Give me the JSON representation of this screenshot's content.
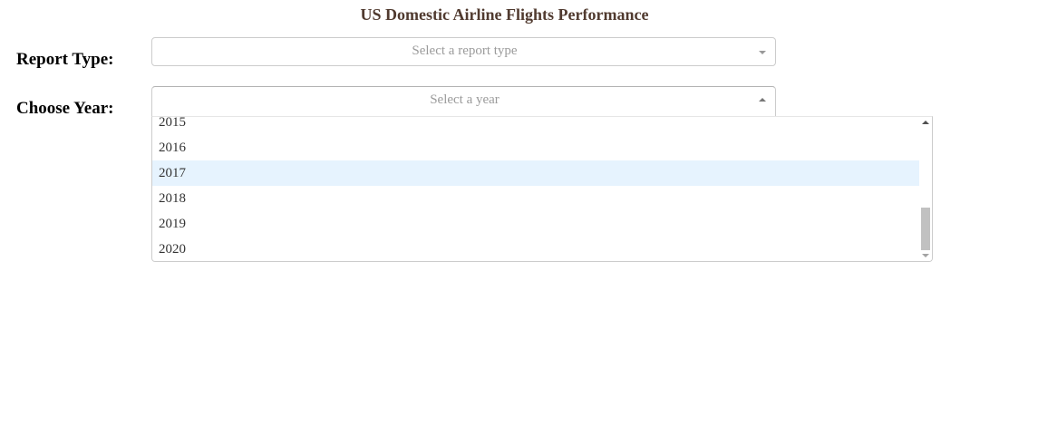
{
  "header": {
    "title": "US Domestic Airline Flights Performance"
  },
  "report_type": {
    "label": "Report Type:",
    "placeholder": "Select a report type"
  },
  "year": {
    "label": "Choose Year:",
    "placeholder": "Select a year",
    "menu_open": true,
    "focused_option": "2017",
    "options": [
      "2015",
      "2016",
      "2017",
      "2018",
      "2019",
      "2020"
    ]
  },
  "icons": {
    "report_arrow": "chevron-down-icon",
    "year_arrow": "chevron-up-icon",
    "scroll_up": "scroll-up-arrow-icon",
    "scroll_down": "scroll-down-arrow-icon"
  },
  "colors": {
    "title": "#503a2f",
    "placeholder": "#9b9b9b",
    "option_focus": "#e6f3fe",
    "border": "#cccccc"
  }
}
